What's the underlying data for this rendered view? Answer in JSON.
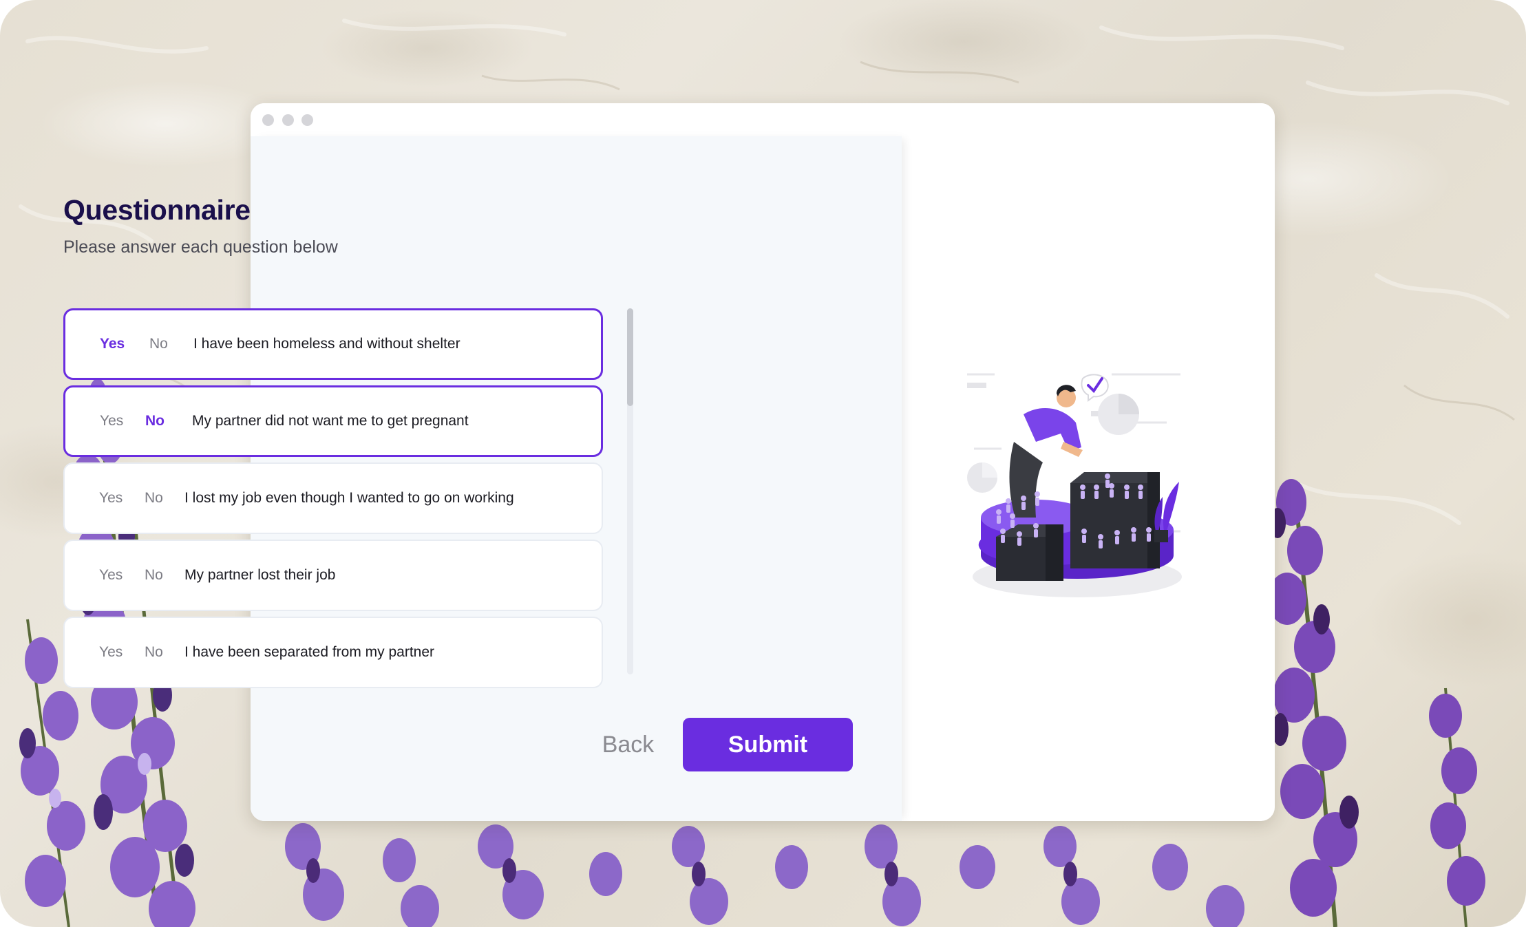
{
  "questionnaire": {
    "title": "Questionnaire",
    "subtitle": "Please answer each question below",
    "yes_label": "Yes",
    "no_label": "No",
    "questions": [
      {
        "text": "I have been homeless and without shelter",
        "answer": "Yes"
      },
      {
        "text": "My partner did not want me to get pregnant",
        "answer": "No"
      },
      {
        "text": "I lost my job even though I wanted to go on working",
        "answer": null
      },
      {
        "text": "My partner lost their job",
        "answer": null
      },
      {
        "text": "I have been separated from my partner",
        "answer": null
      }
    ]
  },
  "actions": {
    "back_label": "Back",
    "submit_label": "Submit"
  },
  "colors": {
    "accent": "#6a2de0",
    "title": "#1a0f4b",
    "panel_bg": "#f5f8fb"
  },
  "icons": {
    "window_controls": [
      "window-dot",
      "window-dot",
      "window-dot"
    ],
    "illustration": "data-analysis-illustration"
  }
}
